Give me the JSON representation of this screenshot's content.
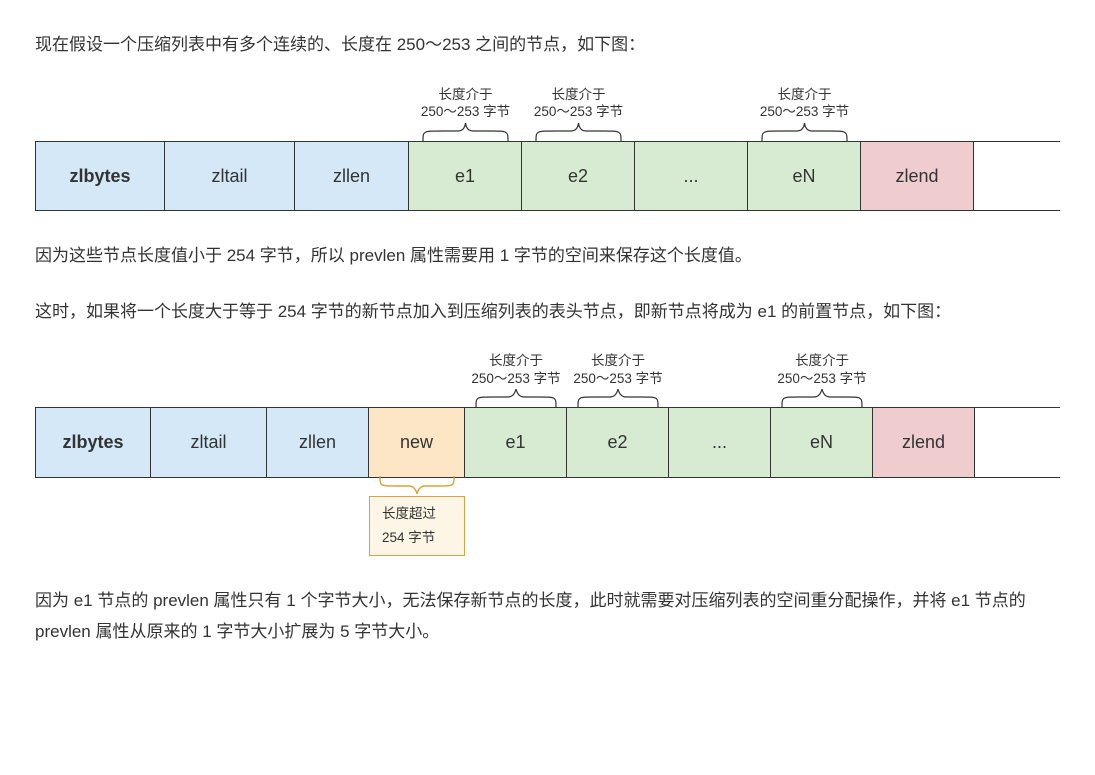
{
  "para1": "现在假设一个压缩列表中有多个连续的、长度在 250～253 之间的节点，如下图：",
  "diagram1": {
    "labels": {
      "e1": {
        "line1": "长度介于",
        "line2": "250～253 字节"
      },
      "e2": {
        "line1": "长度介于",
        "line2": "250～253 字节"
      },
      "eN": {
        "line1": "长度介于",
        "line2": "250～253 字节"
      }
    },
    "cells": {
      "zlbytes": "zlbytes",
      "zltail": "zltail",
      "zllen": "zllen",
      "e1": "e1",
      "e2": "e2",
      "dots": "...",
      "eN": "eN",
      "zlend": "zlend"
    }
  },
  "para2": "因为这些节点长度值小于 254 字节，所以 prevlen 属性需要用 1 字节的空间来保存这个长度值。",
  "para3": "这时，如果将一个长度大于等于 254 字节的新节点加入到压缩列表的表头节点，即新节点将成为 e1 的前置节点，如下图：",
  "diagram2": {
    "labels": {
      "e1": {
        "line1": "长度介于",
        "line2": "250～253 字节"
      },
      "e2": {
        "line1": "长度介于",
        "line2": "250～253 字节"
      },
      "eN": {
        "line1": "长度介于",
        "line2": "250～253 字节"
      }
    },
    "cells": {
      "zlbytes": "zlbytes",
      "zltail": "zltail",
      "zllen": "zllen",
      "new": "new",
      "e1": "e1",
      "e2": "e2",
      "dots": "...",
      "eN": "eN",
      "zlend": "zlend"
    },
    "bottom_label": "长度超过 254 字节"
  },
  "para4": "因为 e1 节点的 prevlen 属性只有 1 个字节大小，无法保存新节点的长度，此时就需要对压缩列表的空间重分配操作，并将 e1 节点的 prevlen 属性从原来的 1 字节大小扩展为 5 字节大小。"
}
